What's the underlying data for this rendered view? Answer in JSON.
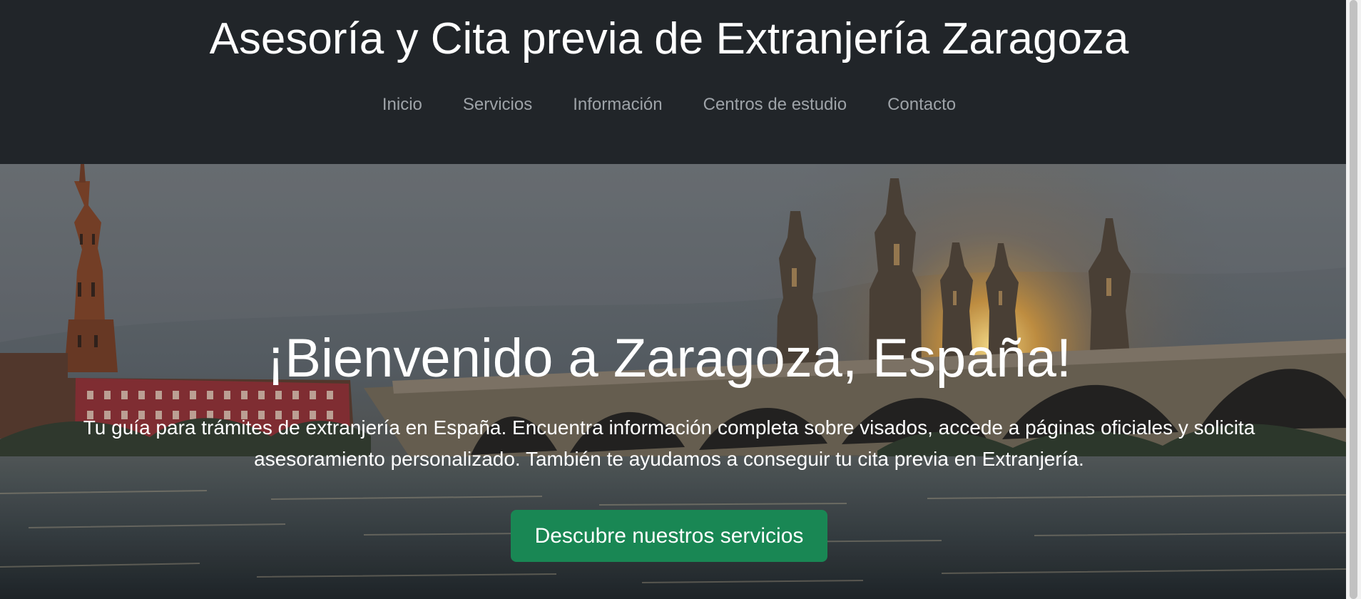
{
  "header": {
    "title": "Asesoría y Cita previa de Extranjería Zaragoza",
    "nav": [
      "Inicio",
      "Servicios",
      "Información",
      "Centros de estudio",
      "Contacto"
    ]
  },
  "hero": {
    "title": "¡Bienvenido a Zaragoza, España!",
    "text": "Tu guía para trámites de extranjería en España. Encuentra información completa sobre visados, accede a páginas oficiales y solicita asesoramiento personalizado. También te ayudamos a conseguir tu cita previa en Extranjería.",
    "button": "Descubre nuestros servicios",
    "image": "zaragoza-sunset-bridge-skyline"
  },
  "colors": {
    "header_bg": "#212529",
    "nav_text": "#9ea3a8",
    "button_bg": "#198754",
    "text_light": "#ffffff"
  }
}
